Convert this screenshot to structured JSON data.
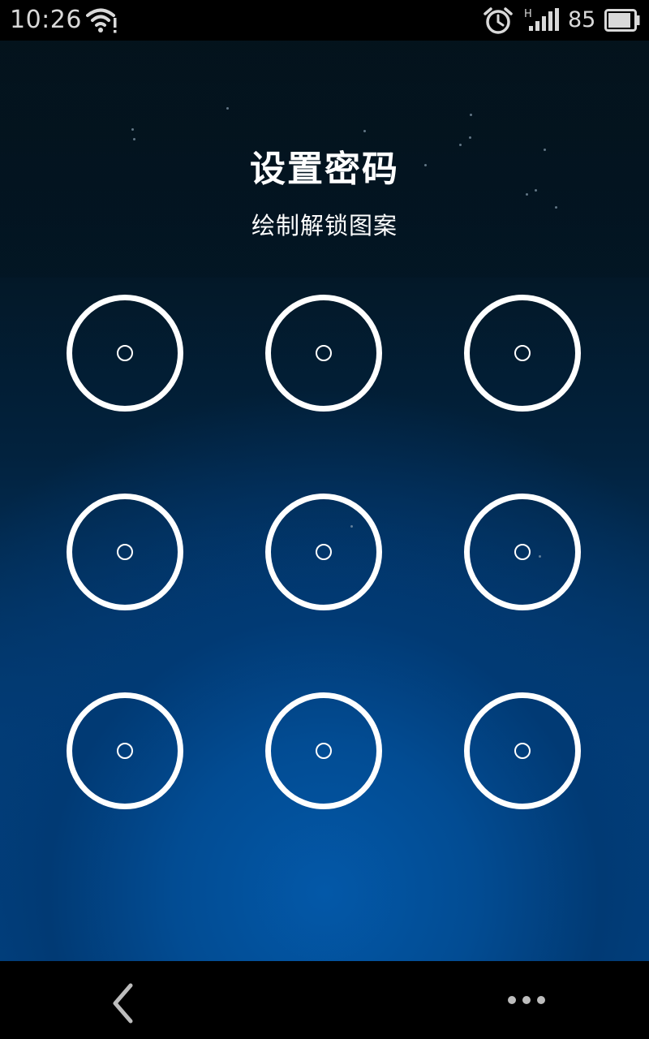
{
  "status_bar": {
    "time": "10:26",
    "battery_level": "85",
    "icons": [
      "wifi-alert-icon",
      "alarm-clock-icon",
      "signal-h-icon",
      "battery-icon"
    ]
  },
  "screen": {
    "title": "设置密码",
    "subtitle": "绘制解锁图案",
    "pattern_nodes": 9
  },
  "nav_bar": {
    "icons": [
      "back-chevron-icon",
      "more-dots-icon"
    ]
  },
  "colors": {
    "background_top": "#04111a",
    "background_bottom": "#024a91",
    "ring": "#ffffff",
    "text": "#ffffff"
  }
}
